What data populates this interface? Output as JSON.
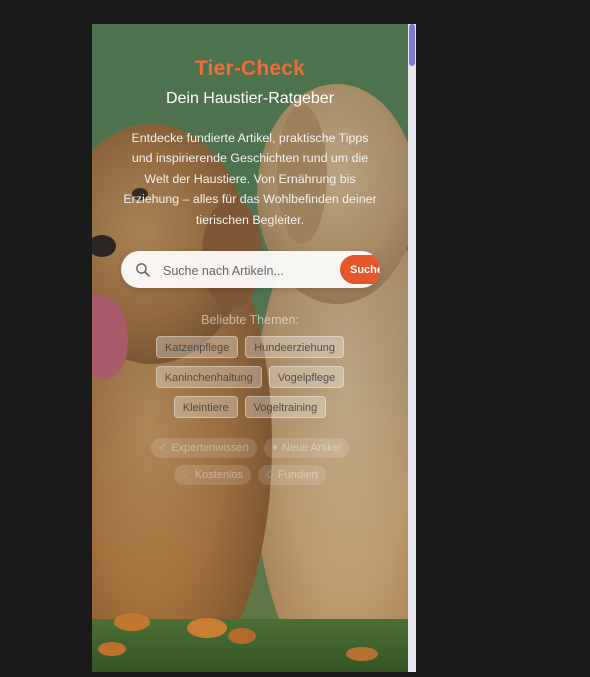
{
  "hero": {
    "title": "Tier-Check",
    "subtitle": "Dein Haustier-Ratgeber",
    "intro": "Entdecke fundierte Artikel, praktische Tipps und inspirierende Geschichten rund um die Welt der Haustiere. Von Ernährung bis Erziehung – alles für das Wohlbefinden deiner tierischen Begleiter."
  },
  "search": {
    "placeholder": "Suche nach Artikeln...",
    "button_label": "Suchen",
    "icon": "search-icon"
  },
  "popular": {
    "label": "Beliebte Themen:",
    "tags": [
      "Katzenpflege",
      "Hundeerziehung",
      "Kaninchenhaltung",
      "Vogelpflege",
      "Kleintiere",
      "Vogeltraining"
    ]
  },
  "features": [
    {
      "icon": "expert-icon",
      "label": "Expertenwissen"
    },
    {
      "icon": "new-icon",
      "label": "Neue Artikel"
    },
    {
      "icon": "heart-icon",
      "label": "Kostenlos"
    },
    {
      "icon": "check-icon",
      "label": "Fundiert"
    }
  ],
  "colors": {
    "brand": "#f06c3a",
    "search_button": "#e5562a",
    "scrollbar_thumb": "#7f78d6",
    "page_background": "#1a1a1a"
  }
}
